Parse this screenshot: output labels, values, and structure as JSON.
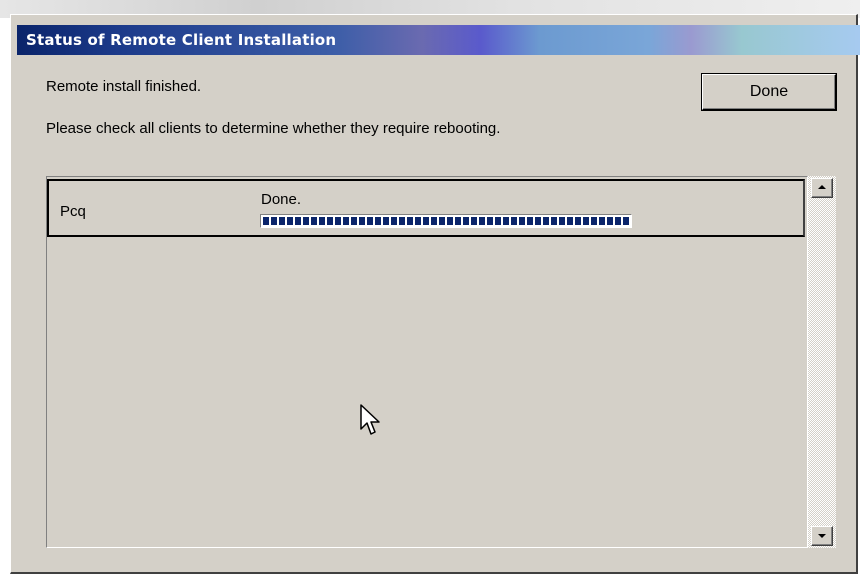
{
  "window": {
    "title": "Status of Remote Client Installation"
  },
  "messages": {
    "finished": "Remote install finished.",
    "instruction": "Please check all clients to determine whether they require rebooting."
  },
  "buttons": {
    "done_label": "Done"
  },
  "clients": [
    {
      "name": "Pcq",
      "status": "Done.",
      "progress_percent": 100
    }
  ],
  "colors": {
    "progress_fill": "#0a246a",
    "dialog_face": "#d4d0c8",
    "title_text": "#ffffff"
  },
  "icons": {
    "scroll_up": "scroll-up-arrow-icon",
    "scroll_down": "scroll-down-arrow-icon",
    "pointer": "mouse-pointer-icon"
  }
}
